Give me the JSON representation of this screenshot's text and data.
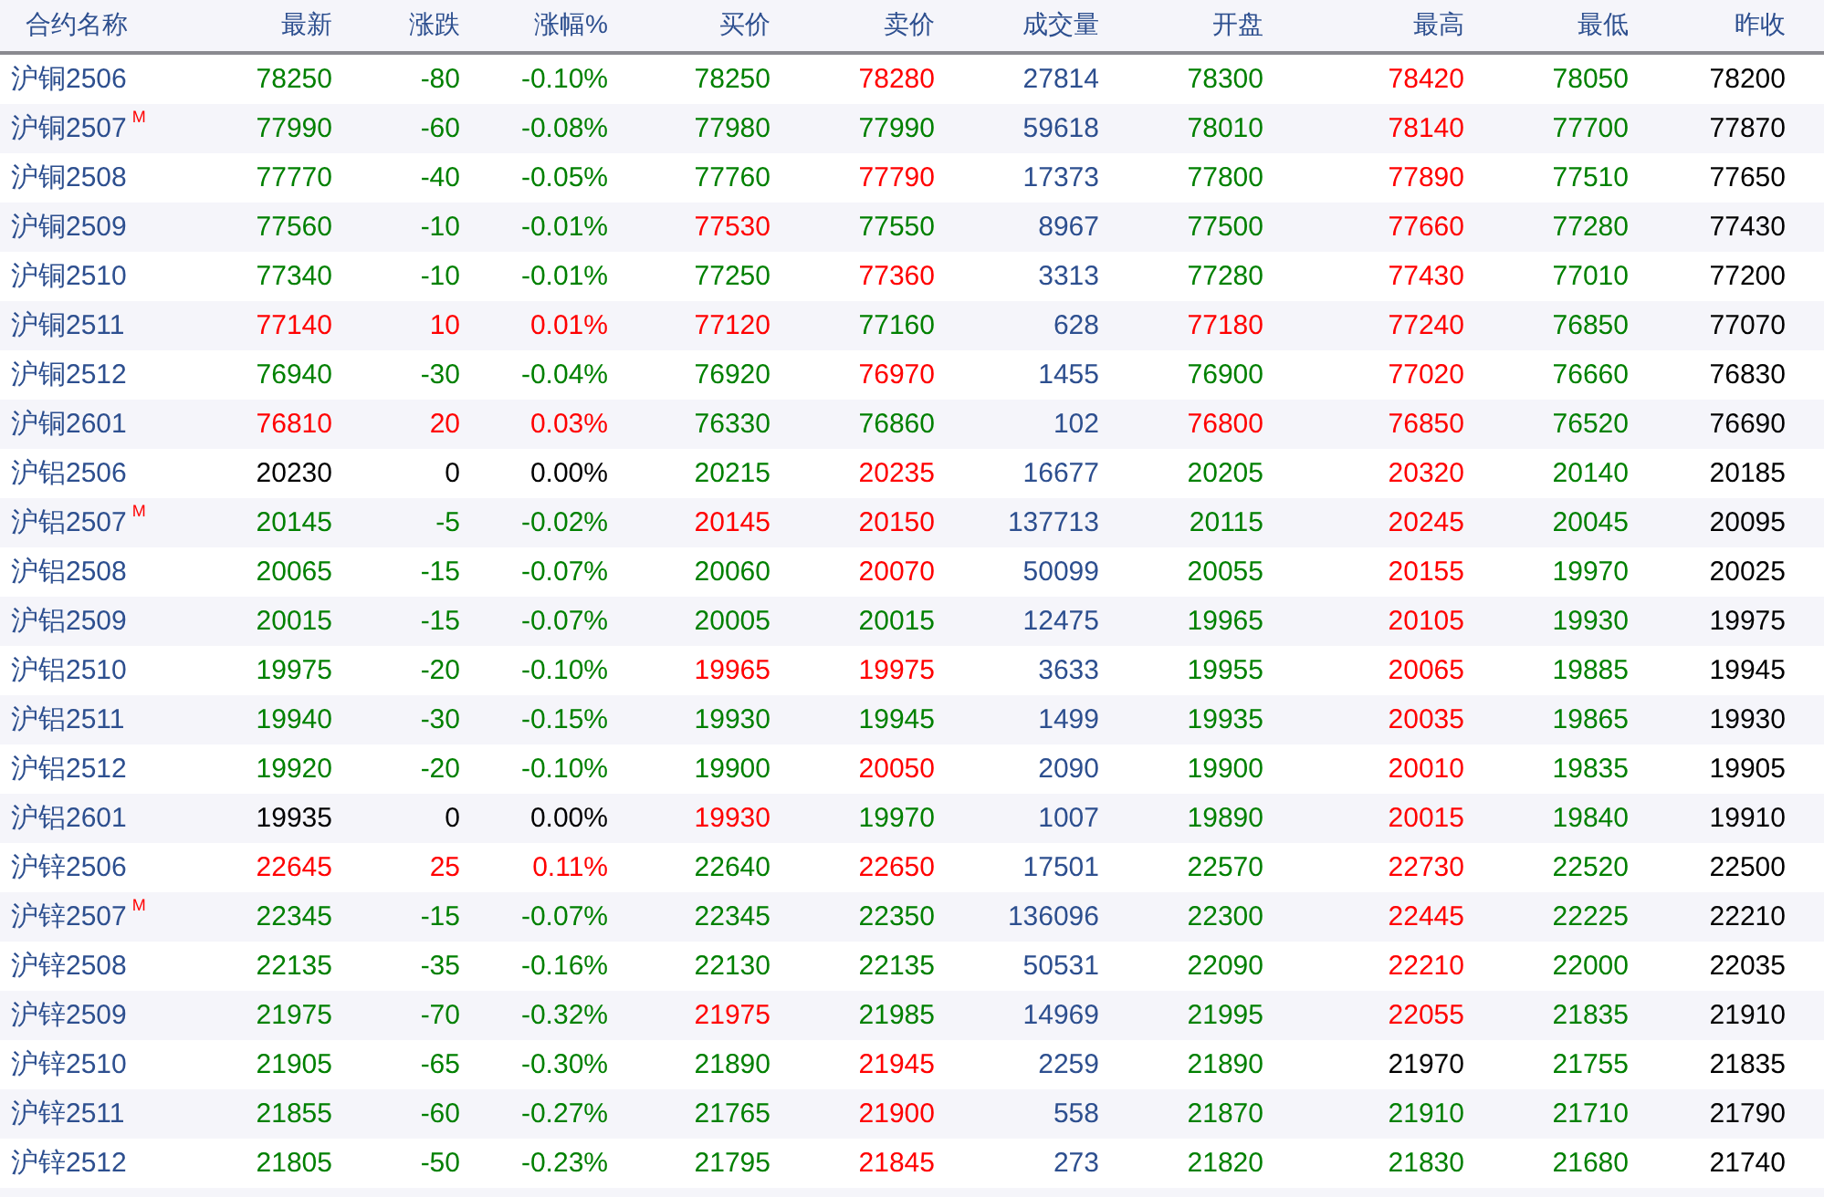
{
  "columns": [
    "合约名称",
    "最新",
    "涨跌",
    "涨幅%",
    "买价",
    "卖价",
    "成交量",
    "开盘",
    "最高",
    "最低",
    "昨收"
  ],
  "rows": [
    {
      "name": "沪铜2506",
      "cells": [
        {
          "text": "78250",
          "color": "#008000"
        },
        {
          "text": "-80",
          "color": "#008000"
        },
        {
          "text": "-0.10%",
          "color": "#008000"
        },
        {
          "text": "78250",
          "color": "#008000"
        },
        {
          "text": "78280",
          "color": "#ff0000"
        },
        {
          "text": "27814",
          "color": "#2d4f8f"
        },
        {
          "text": "78300",
          "color": "#008000"
        },
        {
          "text": "78420",
          "color": "#ff0000"
        },
        {
          "text": "78050",
          "color": "#008000"
        },
        {
          "text": "78200",
          "color": "#000000"
        }
      ]
    },
    {
      "name": "沪铜2507",
      "badge": "M",
      "cells": [
        {
          "text": "77990",
          "color": "#008000"
        },
        {
          "text": "-60",
          "color": "#008000"
        },
        {
          "text": "-0.08%",
          "color": "#008000"
        },
        {
          "text": "77980",
          "color": "#008000"
        },
        {
          "text": "77990",
          "color": "#008000"
        },
        {
          "text": "59618",
          "color": "#2d4f8f"
        },
        {
          "text": "78010",
          "color": "#008000"
        },
        {
          "text": "78140",
          "color": "#ff0000"
        },
        {
          "text": "77700",
          "color": "#008000"
        },
        {
          "text": "77870",
          "color": "#000000"
        }
      ]
    },
    {
      "name": "沪铜2508",
      "cells": [
        {
          "text": "77770",
          "color": "#008000"
        },
        {
          "text": "-40",
          "color": "#008000"
        },
        {
          "text": "-0.05%",
          "color": "#008000"
        },
        {
          "text": "77760",
          "color": "#008000"
        },
        {
          "text": "77790",
          "color": "#ff0000"
        },
        {
          "text": "17373",
          "color": "#2d4f8f"
        },
        {
          "text": "77800",
          "color": "#008000"
        },
        {
          "text": "77890",
          "color": "#ff0000"
        },
        {
          "text": "77510",
          "color": "#008000"
        },
        {
          "text": "77650",
          "color": "#000000"
        }
      ]
    },
    {
      "name": "沪铜2509",
      "cells": [
        {
          "text": "77560",
          "color": "#008000"
        },
        {
          "text": "-10",
          "color": "#008000"
        },
        {
          "text": "-0.01%",
          "color": "#008000"
        },
        {
          "text": "77530",
          "color": "#ff0000"
        },
        {
          "text": "77550",
          "color": "#008000"
        },
        {
          "text": "8967",
          "color": "#2d4f8f"
        },
        {
          "text": "77500",
          "color": "#008000"
        },
        {
          "text": "77660",
          "color": "#ff0000"
        },
        {
          "text": "77280",
          "color": "#008000"
        },
        {
          "text": "77430",
          "color": "#000000"
        }
      ]
    },
    {
      "name": "沪铜2510",
      "cells": [
        {
          "text": "77340",
          "color": "#008000"
        },
        {
          "text": "-10",
          "color": "#008000"
        },
        {
          "text": "-0.01%",
          "color": "#008000"
        },
        {
          "text": "77250",
          "color": "#008000"
        },
        {
          "text": "77360",
          "color": "#ff0000"
        },
        {
          "text": "3313",
          "color": "#2d4f8f"
        },
        {
          "text": "77280",
          "color": "#008000"
        },
        {
          "text": "77430",
          "color": "#ff0000"
        },
        {
          "text": "77010",
          "color": "#008000"
        },
        {
          "text": "77200",
          "color": "#000000"
        }
      ]
    },
    {
      "name": "沪铜2511",
      "cells": [
        {
          "text": "77140",
          "color": "#ff0000"
        },
        {
          "text": "10",
          "color": "#ff0000"
        },
        {
          "text": "0.01%",
          "color": "#ff0000"
        },
        {
          "text": "77120",
          "color": "#ff0000"
        },
        {
          "text": "77160",
          "color": "#008000"
        },
        {
          "text": "628",
          "color": "#2d4f8f"
        },
        {
          "text": "77180",
          "color": "#ff0000"
        },
        {
          "text": "77240",
          "color": "#ff0000"
        },
        {
          "text": "76850",
          "color": "#008000"
        },
        {
          "text": "77070",
          "color": "#000000"
        }
      ]
    },
    {
      "name": "沪铜2512",
      "cells": [
        {
          "text": "76940",
          "color": "#008000"
        },
        {
          "text": "-30",
          "color": "#008000"
        },
        {
          "text": "-0.04%",
          "color": "#008000"
        },
        {
          "text": "76920",
          "color": "#008000"
        },
        {
          "text": "76970",
          "color": "#ff0000"
        },
        {
          "text": "1455",
          "color": "#2d4f8f"
        },
        {
          "text": "76900",
          "color": "#008000"
        },
        {
          "text": "77020",
          "color": "#ff0000"
        },
        {
          "text": "76660",
          "color": "#008000"
        },
        {
          "text": "76830",
          "color": "#000000"
        }
      ]
    },
    {
      "name": "沪铜2601",
      "cells": [
        {
          "text": "76810",
          "color": "#ff0000"
        },
        {
          "text": "20",
          "color": "#ff0000"
        },
        {
          "text": "0.03%",
          "color": "#ff0000"
        },
        {
          "text": "76330",
          "color": "#008000"
        },
        {
          "text": "76860",
          "color": "#008000"
        },
        {
          "text": "102",
          "color": "#2d4f8f"
        },
        {
          "text": "76800",
          "color": "#ff0000"
        },
        {
          "text": "76850",
          "color": "#ff0000"
        },
        {
          "text": "76520",
          "color": "#008000"
        },
        {
          "text": "76690",
          "color": "#000000"
        }
      ]
    },
    {
      "name": "沪铝2506",
      "cells": [
        {
          "text": "20230",
          "color": "#000000"
        },
        {
          "text": "0",
          "color": "#000000"
        },
        {
          "text": "0.00%",
          "color": "#000000"
        },
        {
          "text": "20215",
          "color": "#008000"
        },
        {
          "text": "20235",
          "color": "#ff0000"
        },
        {
          "text": "16677",
          "color": "#2d4f8f"
        },
        {
          "text": "20205",
          "color": "#008000"
        },
        {
          "text": "20320",
          "color": "#ff0000"
        },
        {
          "text": "20140",
          "color": "#008000"
        },
        {
          "text": "20185",
          "color": "#000000"
        }
      ]
    },
    {
      "name": "沪铝2507",
      "badge": "M",
      "cells": [
        {
          "text": "20145",
          "color": "#008000"
        },
        {
          "text": "-5",
          "color": "#008000"
        },
        {
          "text": "-0.02%",
          "color": "#008000"
        },
        {
          "text": "20145",
          "color": "#ff0000"
        },
        {
          "text": "20150",
          "color": "#ff0000"
        },
        {
          "text": "137713",
          "color": "#2d4f8f"
        },
        {
          "text": "20115",
          "color": "#008000"
        },
        {
          "text": "20245",
          "color": "#ff0000"
        },
        {
          "text": "20045",
          "color": "#008000"
        },
        {
          "text": "20095",
          "color": "#000000"
        }
      ]
    },
    {
      "name": "沪铝2508",
      "cells": [
        {
          "text": "20065",
          "color": "#008000"
        },
        {
          "text": "-15",
          "color": "#008000"
        },
        {
          "text": "-0.07%",
          "color": "#008000"
        },
        {
          "text": "20060",
          "color": "#008000"
        },
        {
          "text": "20070",
          "color": "#ff0000"
        },
        {
          "text": "50099",
          "color": "#2d4f8f"
        },
        {
          "text": "20055",
          "color": "#008000"
        },
        {
          "text": "20155",
          "color": "#ff0000"
        },
        {
          "text": "19970",
          "color": "#008000"
        },
        {
          "text": "20025",
          "color": "#000000"
        }
      ]
    },
    {
      "name": "沪铝2509",
      "cells": [
        {
          "text": "20015",
          "color": "#008000"
        },
        {
          "text": "-15",
          "color": "#008000"
        },
        {
          "text": "-0.07%",
          "color": "#008000"
        },
        {
          "text": "20005",
          "color": "#008000"
        },
        {
          "text": "20015",
          "color": "#008000"
        },
        {
          "text": "12475",
          "color": "#2d4f8f"
        },
        {
          "text": "19965",
          "color": "#008000"
        },
        {
          "text": "20105",
          "color": "#ff0000"
        },
        {
          "text": "19930",
          "color": "#008000"
        },
        {
          "text": "19975",
          "color": "#000000"
        }
      ]
    },
    {
      "name": "沪铝2510",
      "cells": [
        {
          "text": "19975",
          "color": "#008000"
        },
        {
          "text": "-20",
          "color": "#008000"
        },
        {
          "text": "-0.10%",
          "color": "#008000"
        },
        {
          "text": "19965",
          "color": "#ff0000"
        },
        {
          "text": "19975",
          "color": "#ff0000"
        },
        {
          "text": "3633",
          "color": "#2d4f8f"
        },
        {
          "text": "19955",
          "color": "#008000"
        },
        {
          "text": "20065",
          "color": "#ff0000"
        },
        {
          "text": "19885",
          "color": "#008000"
        },
        {
          "text": "19945",
          "color": "#000000"
        }
      ]
    },
    {
      "name": "沪铝2511",
      "cells": [
        {
          "text": "19940",
          "color": "#008000"
        },
        {
          "text": "-30",
          "color": "#008000"
        },
        {
          "text": "-0.15%",
          "color": "#008000"
        },
        {
          "text": "19930",
          "color": "#008000"
        },
        {
          "text": "19945",
          "color": "#008000"
        },
        {
          "text": "1499",
          "color": "#2d4f8f"
        },
        {
          "text": "19935",
          "color": "#008000"
        },
        {
          "text": "20035",
          "color": "#ff0000"
        },
        {
          "text": "19865",
          "color": "#008000"
        },
        {
          "text": "19930",
          "color": "#000000"
        }
      ]
    },
    {
      "name": "沪铝2512",
      "cells": [
        {
          "text": "19920",
          "color": "#008000"
        },
        {
          "text": "-20",
          "color": "#008000"
        },
        {
          "text": "-0.10%",
          "color": "#008000"
        },
        {
          "text": "19900",
          "color": "#008000"
        },
        {
          "text": "20050",
          "color": "#ff0000"
        },
        {
          "text": "2090",
          "color": "#2d4f8f"
        },
        {
          "text": "19900",
          "color": "#008000"
        },
        {
          "text": "20010",
          "color": "#ff0000"
        },
        {
          "text": "19835",
          "color": "#008000"
        },
        {
          "text": "19905",
          "color": "#000000"
        }
      ]
    },
    {
      "name": "沪铝2601",
      "cells": [
        {
          "text": "19935",
          "color": "#000000"
        },
        {
          "text": "0",
          "color": "#000000"
        },
        {
          "text": "0.00%",
          "color": "#000000"
        },
        {
          "text": "19930",
          "color": "#ff0000"
        },
        {
          "text": "19970",
          "color": "#008000"
        },
        {
          "text": "1007",
          "color": "#2d4f8f"
        },
        {
          "text": "19890",
          "color": "#008000"
        },
        {
          "text": "20015",
          "color": "#ff0000"
        },
        {
          "text": "19840",
          "color": "#008000"
        },
        {
          "text": "19910",
          "color": "#000000"
        }
      ]
    },
    {
      "name": "沪锌2506",
      "cells": [
        {
          "text": "22645",
          "color": "#ff0000"
        },
        {
          "text": "25",
          "color": "#ff0000"
        },
        {
          "text": "0.11%",
          "color": "#ff0000"
        },
        {
          "text": "22640",
          "color": "#008000"
        },
        {
          "text": "22650",
          "color": "#ff0000"
        },
        {
          "text": "17501",
          "color": "#2d4f8f"
        },
        {
          "text": "22570",
          "color": "#008000"
        },
        {
          "text": "22730",
          "color": "#ff0000"
        },
        {
          "text": "22520",
          "color": "#008000"
        },
        {
          "text": "22500",
          "color": "#000000"
        }
      ]
    },
    {
      "name": "沪锌2507",
      "badge": "M",
      "cells": [
        {
          "text": "22345",
          "color": "#008000"
        },
        {
          "text": "-15",
          "color": "#008000"
        },
        {
          "text": "-0.07%",
          "color": "#008000"
        },
        {
          "text": "22345",
          "color": "#008000"
        },
        {
          "text": "22350",
          "color": "#008000"
        },
        {
          "text": "136096",
          "color": "#2d4f8f"
        },
        {
          "text": "22300",
          "color": "#008000"
        },
        {
          "text": "22445",
          "color": "#ff0000"
        },
        {
          "text": "22225",
          "color": "#008000"
        },
        {
          "text": "22210",
          "color": "#000000"
        }
      ]
    },
    {
      "name": "沪锌2508",
      "cells": [
        {
          "text": "22135",
          "color": "#008000"
        },
        {
          "text": "-35",
          "color": "#008000"
        },
        {
          "text": "-0.16%",
          "color": "#008000"
        },
        {
          "text": "22130",
          "color": "#008000"
        },
        {
          "text": "22135",
          "color": "#008000"
        },
        {
          "text": "50531",
          "color": "#2d4f8f"
        },
        {
          "text": "22090",
          "color": "#008000"
        },
        {
          "text": "22210",
          "color": "#ff0000"
        },
        {
          "text": "22000",
          "color": "#008000"
        },
        {
          "text": "22035",
          "color": "#000000"
        }
      ]
    },
    {
      "name": "沪锌2509",
      "cells": [
        {
          "text": "21975",
          "color": "#008000"
        },
        {
          "text": "-70",
          "color": "#008000"
        },
        {
          "text": "-0.32%",
          "color": "#008000"
        },
        {
          "text": "21975",
          "color": "#ff0000"
        },
        {
          "text": "21985",
          "color": "#008000"
        },
        {
          "text": "14969",
          "color": "#2d4f8f"
        },
        {
          "text": "21995",
          "color": "#008000"
        },
        {
          "text": "22055",
          "color": "#ff0000"
        },
        {
          "text": "21835",
          "color": "#008000"
        },
        {
          "text": "21910",
          "color": "#000000"
        }
      ]
    },
    {
      "name": "沪锌2510",
      "cells": [
        {
          "text": "21905",
          "color": "#008000"
        },
        {
          "text": "-65",
          "color": "#008000"
        },
        {
          "text": "-0.30%",
          "color": "#008000"
        },
        {
          "text": "21890",
          "color": "#008000"
        },
        {
          "text": "21945",
          "color": "#ff0000"
        },
        {
          "text": "2259",
          "color": "#2d4f8f"
        },
        {
          "text": "21890",
          "color": "#008000"
        },
        {
          "text": "21970",
          "color": "#000000"
        },
        {
          "text": "21755",
          "color": "#008000"
        },
        {
          "text": "21835",
          "color": "#000000"
        }
      ]
    },
    {
      "name": "沪锌2511",
      "cells": [
        {
          "text": "21855",
          "color": "#008000"
        },
        {
          "text": "-60",
          "color": "#008000"
        },
        {
          "text": "-0.27%",
          "color": "#008000"
        },
        {
          "text": "21765",
          "color": "#008000"
        },
        {
          "text": "21900",
          "color": "#ff0000"
        },
        {
          "text": "558",
          "color": "#2d4f8f"
        },
        {
          "text": "21870",
          "color": "#008000"
        },
        {
          "text": "21910",
          "color": "#008000"
        },
        {
          "text": "21710",
          "color": "#008000"
        },
        {
          "text": "21790",
          "color": "#000000"
        }
      ]
    },
    {
      "name": "沪锌2512",
      "cells": [
        {
          "text": "21805",
          "color": "#008000"
        },
        {
          "text": "-50",
          "color": "#008000"
        },
        {
          "text": "-0.23%",
          "color": "#008000"
        },
        {
          "text": "21795",
          "color": "#008000"
        },
        {
          "text": "21845",
          "color": "#ff0000"
        },
        {
          "text": "273",
          "color": "#2d4f8f"
        },
        {
          "text": "21820",
          "color": "#008000"
        },
        {
          "text": "21830",
          "color": "#008000"
        },
        {
          "text": "21680",
          "color": "#008000"
        },
        {
          "text": "21740",
          "color": "#000000"
        }
      ]
    }
  ]
}
